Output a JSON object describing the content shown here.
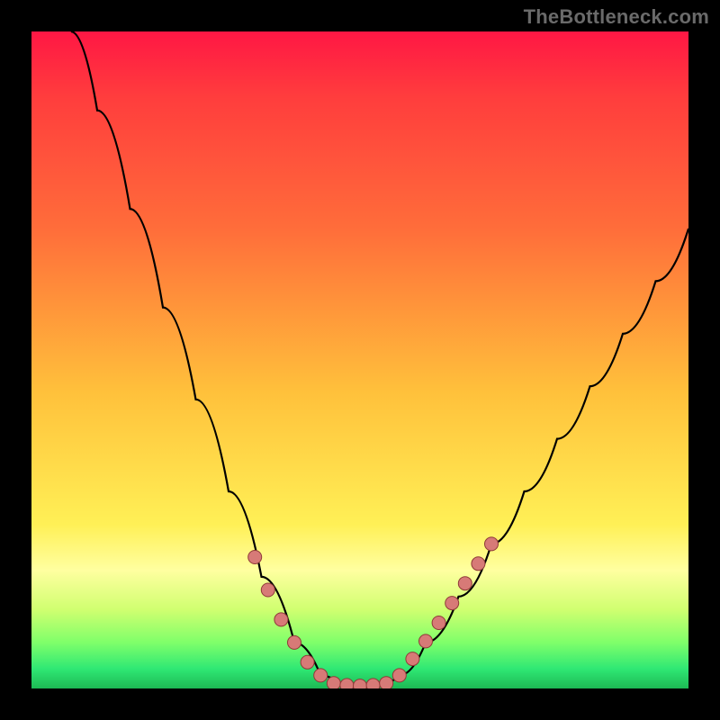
{
  "attribution": "TheBottleneck.com",
  "colors": {
    "background_frame": "#000000",
    "curve_stroke": "#000000",
    "dot_fill": "#d77a77",
    "dot_stroke": "#8f3a38",
    "gradient_top": "#ff1744",
    "gradient_mid": "#fff056",
    "gradient_bottom": "#1db954"
  },
  "chart_data": {
    "type": "line",
    "title": "",
    "xlabel": "",
    "ylabel": "",
    "xlim": [
      0,
      100
    ],
    "ylim": [
      0,
      100
    ],
    "grid": false,
    "legend": false,
    "curve": [
      {
        "x": 6,
        "y": 100
      },
      {
        "x": 10,
        "y": 88
      },
      {
        "x": 15,
        "y": 73
      },
      {
        "x": 20,
        "y": 58
      },
      {
        "x": 25,
        "y": 44
      },
      {
        "x": 30,
        "y": 30
      },
      {
        "x": 35,
        "y": 17
      },
      {
        "x": 40,
        "y": 7
      },
      {
        "x": 44,
        "y": 2
      },
      {
        "x": 47,
        "y": 0.6
      },
      {
        "x": 50,
        "y": 0.4
      },
      {
        "x": 53,
        "y": 0.6
      },
      {
        "x": 56,
        "y": 2
      },
      {
        "x": 60,
        "y": 7
      },
      {
        "x": 65,
        "y": 14
      },
      {
        "x": 70,
        "y": 22
      },
      {
        "x": 75,
        "y": 30
      },
      {
        "x": 80,
        "y": 38
      },
      {
        "x": 85,
        "y": 46
      },
      {
        "x": 90,
        "y": 54
      },
      {
        "x": 95,
        "y": 62
      },
      {
        "x": 100,
        "y": 70
      }
    ],
    "dots": [
      {
        "x": 34,
        "y": 20
      },
      {
        "x": 36,
        "y": 15
      },
      {
        "x": 38,
        "y": 10.5
      },
      {
        "x": 40,
        "y": 7
      },
      {
        "x": 42,
        "y": 4
      },
      {
        "x": 44,
        "y": 2
      },
      {
        "x": 46,
        "y": 0.8
      },
      {
        "x": 48,
        "y": 0.5
      },
      {
        "x": 50,
        "y": 0.4
      },
      {
        "x": 52,
        "y": 0.5
      },
      {
        "x": 54,
        "y": 0.8
      },
      {
        "x": 56,
        "y": 2
      },
      {
        "x": 58,
        "y": 4.5
      },
      {
        "x": 60,
        "y": 7.2
      },
      {
        "x": 62,
        "y": 10
      },
      {
        "x": 64,
        "y": 13
      },
      {
        "x": 66,
        "y": 16
      },
      {
        "x": 68,
        "y": 19
      },
      {
        "x": 70,
        "y": 22
      }
    ]
  }
}
